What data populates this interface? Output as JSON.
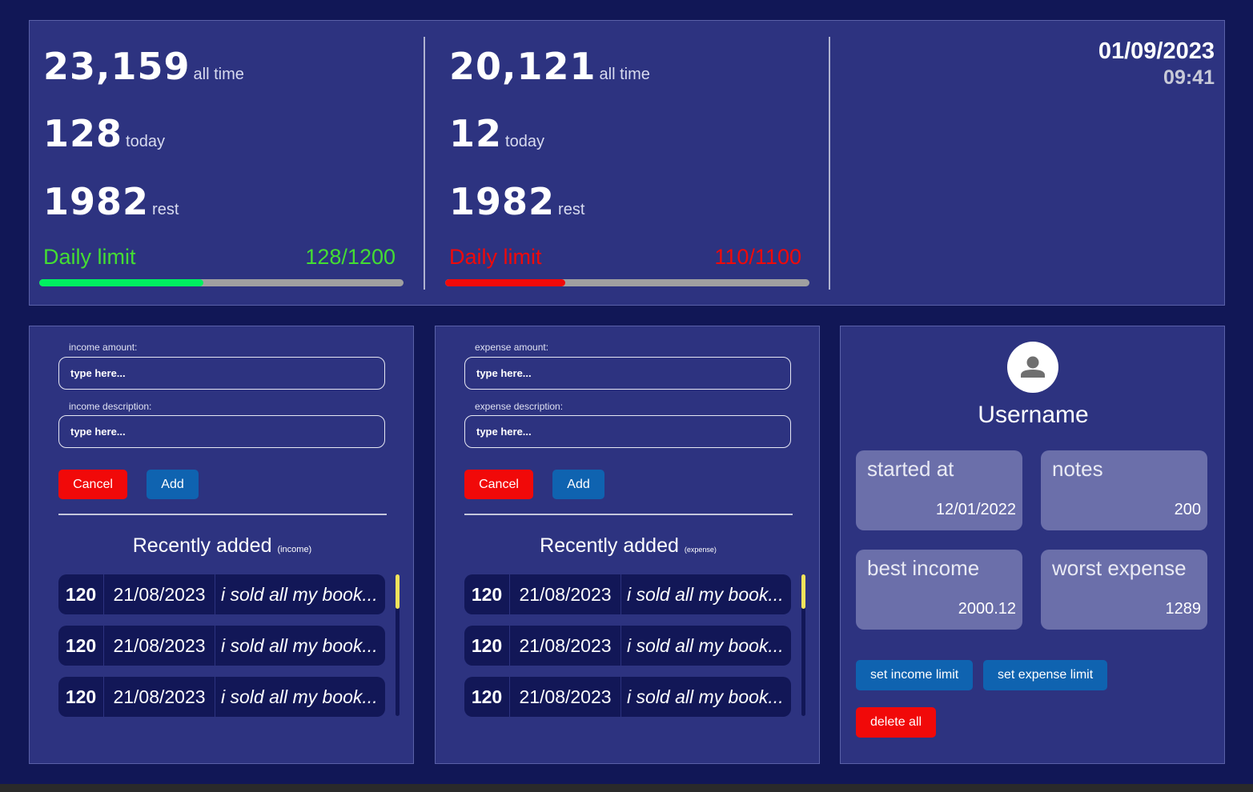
{
  "colors": {
    "green": "#44dd33",
    "green_bar": "#00f060",
    "red": "#f10909",
    "accent_blue": "#0f63b0"
  },
  "income_stats": {
    "all_time": "23,159",
    "all_time_label": "all time",
    "today": "128",
    "today_label": "today",
    "rest": "1982",
    "rest_label": "rest",
    "limit_label": "Daily limit",
    "limit_value": "128/1200",
    "progress": 0.45
  },
  "expense_stats": {
    "all_time": "20,121",
    "all_time_label": "all time",
    "today": "12",
    "today_label": "today",
    "rest": "1982",
    "rest_label": "rest",
    "limit_label": "Daily limit",
    "limit_value": "110/1100",
    "progress": 0.33
  },
  "datetime": {
    "date": "01/09/2023",
    "time": "09:41"
  },
  "income_form": {
    "amount_label": "income amount:",
    "amount_placeholder": "type here...",
    "description_label": "income description:",
    "description_placeholder": "type here...",
    "cancel": "Cancel",
    "add": "Add",
    "recent_title": "Recently added",
    "recent_sub": "(income)",
    "rows": [
      {
        "amount": "120",
        "date": "21/08/2023",
        "desc": "i sold all my book..."
      },
      {
        "amount": "120",
        "date": "21/08/2023",
        "desc": "i sold all my book..."
      },
      {
        "amount": "120",
        "date": "21/08/2023",
        "desc": "i sold all my book..."
      }
    ]
  },
  "expense_form": {
    "amount_label": "expense amount:",
    "amount_placeholder": "type here...",
    "description_label": "expense description:",
    "description_placeholder": "type here...",
    "cancel": "Cancel",
    "add": "Add",
    "recent_title": "Recently added",
    "recent_sub": "(expense)",
    "rows": [
      {
        "amount": "120",
        "date": "21/08/2023",
        "desc": "i sold all my book..."
      },
      {
        "amount": "120",
        "date": "21/08/2023",
        "desc": "i sold all my book..."
      },
      {
        "amount": "120",
        "date": "21/08/2023",
        "desc": "i sold all my book..."
      }
    ]
  },
  "profile": {
    "avatar_icon": "user-icon",
    "username": "Username",
    "cards": [
      {
        "title": "started at",
        "value": "12/01/2022"
      },
      {
        "title": "notes",
        "value": "200"
      },
      {
        "title": "best income",
        "value": "2000.12"
      },
      {
        "title": "worst expense",
        "value": "1289"
      }
    ],
    "set_income_limit": "set income limit",
    "set_expense_limit": "set expense limit",
    "delete_all": "delete all"
  }
}
